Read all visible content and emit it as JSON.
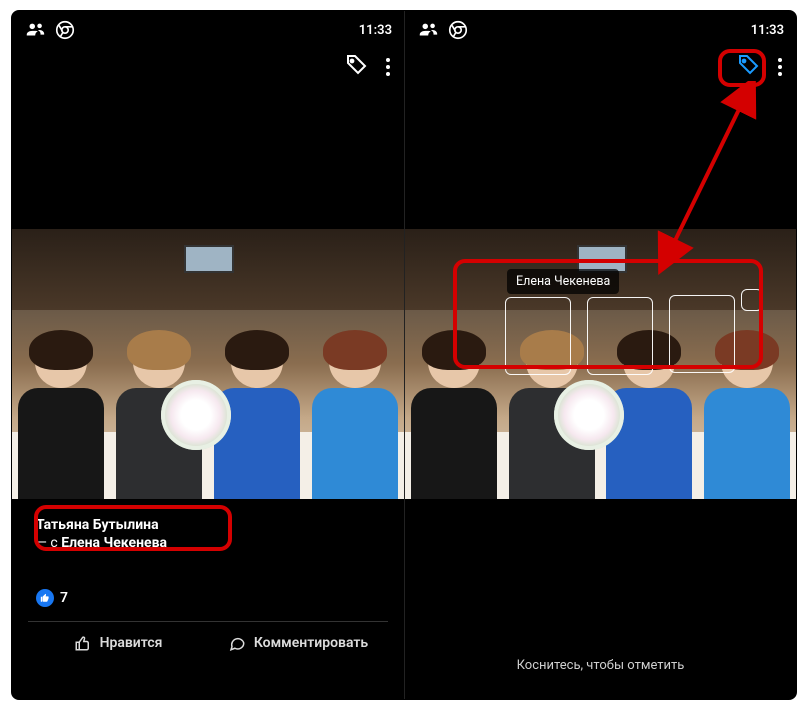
{
  "status": {
    "time": "11:33"
  },
  "icons": {
    "profile": "profile-icon",
    "chrome": "chrome-icon",
    "tag": "tag-icon",
    "more": "more-icon",
    "like_thumb": "like-thumb-icon",
    "like_filled": "like-filled-icon",
    "comment": "comment-icon"
  },
  "left_panel": {
    "owner_name": "Татьяна Бутылина",
    "with_prefix": "— с ",
    "with_name": "Елена Чекенева",
    "like_count": "7",
    "actions": {
      "like_label": "Нравится",
      "comment_label": "Комментировать"
    }
  },
  "right_panel": {
    "face_tag_label": "Елена Чекенева",
    "hint_text": "Коснитесь, чтобы отметить"
  },
  "annotation_arrow": {
    "color": "#d40000"
  }
}
